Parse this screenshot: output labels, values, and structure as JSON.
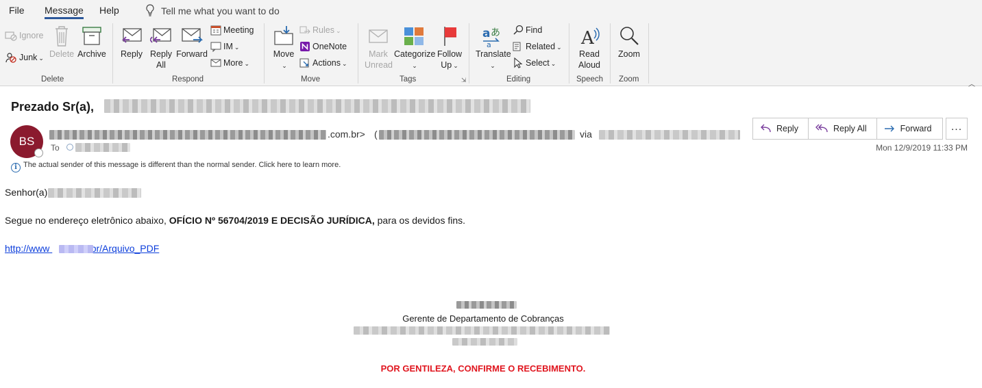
{
  "menu": {
    "tabs": [
      "File",
      "Message",
      "Help"
    ],
    "active_tab": "Message",
    "tell_me": "Tell me what you want to do"
  },
  "ribbon": {
    "delete": {
      "label": "Delete",
      "ignore": "Ignore",
      "junk": "Junk",
      "delete_btn": "Delete",
      "archive": "Archive"
    },
    "respond": {
      "label": "Respond",
      "reply": "Reply",
      "reply_all_1": "Reply",
      "reply_all_2": "All",
      "forward": "Forward",
      "meeting": "Meeting",
      "im": "IM",
      "more": "More"
    },
    "move": {
      "label": "Move",
      "move_btn": "Move",
      "rules": "Rules",
      "onenote": "OneNote",
      "actions": "Actions"
    },
    "tags": {
      "label": "Tags",
      "mark_unread_1": "Mark",
      "mark_unread_2": "Unread",
      "categorize": "Categorize",
      "follow_up_1": "Follow",
      "follow_up_2": "Up"
    },
    "editing": {
      "label": "Editing",
      "translate": "Translate",
      "find": "Find",
      "related": "Related",
      "select": "Select"
    },
    "speech": {
      "label": "Speech",
      "read_aloud_1": "Read",
      "read_aloud_2": "Aloud"
    },
    "zoom": {
      "label": "Zoom",
      "zoom_btn": "Zoom"
    }
  },
  "email": {
    "subject": "Prezado Sr(a),",
    "avatar_initials": "BS",
    "avatar_color": "#8b1a2e",
    "sender_domain": ".com.br>",
    "sender_paren": "(",
    "sender_via": "via",
    "to_label": "To",
    "info_banner": "The actual sender of this message is different than the normal sender. Click here to learn more.",
    "actions": {
      "reply": "Reply",
      "reply_all": "Reply All",
      "forward": "Forward",
      "more": "..."
    },
    "date": "Mon 12/9/2019 11:33 PM"
  },
  "body": {
    "greeting": "Senhor(a)",
    "line_before": "Segue no endereço eletrônico abaixo, ",
    "line_bold": "OFÍCIO Nº 56704/2019 E DECISÃO JURÍDICA,",
    "line_after": " para os devidos fins.",
    "link_prefix": "http://www",
    "link_suffix": "com.br/Arquivo_PDF",
    "signature_title": "Gerente de Departamento de Cobranças",
    "confirm": "POR GENTILEZA, CONFIRME O RECEBIMENTO.",
    "confirm_color": "#e0161f"
  }
}
